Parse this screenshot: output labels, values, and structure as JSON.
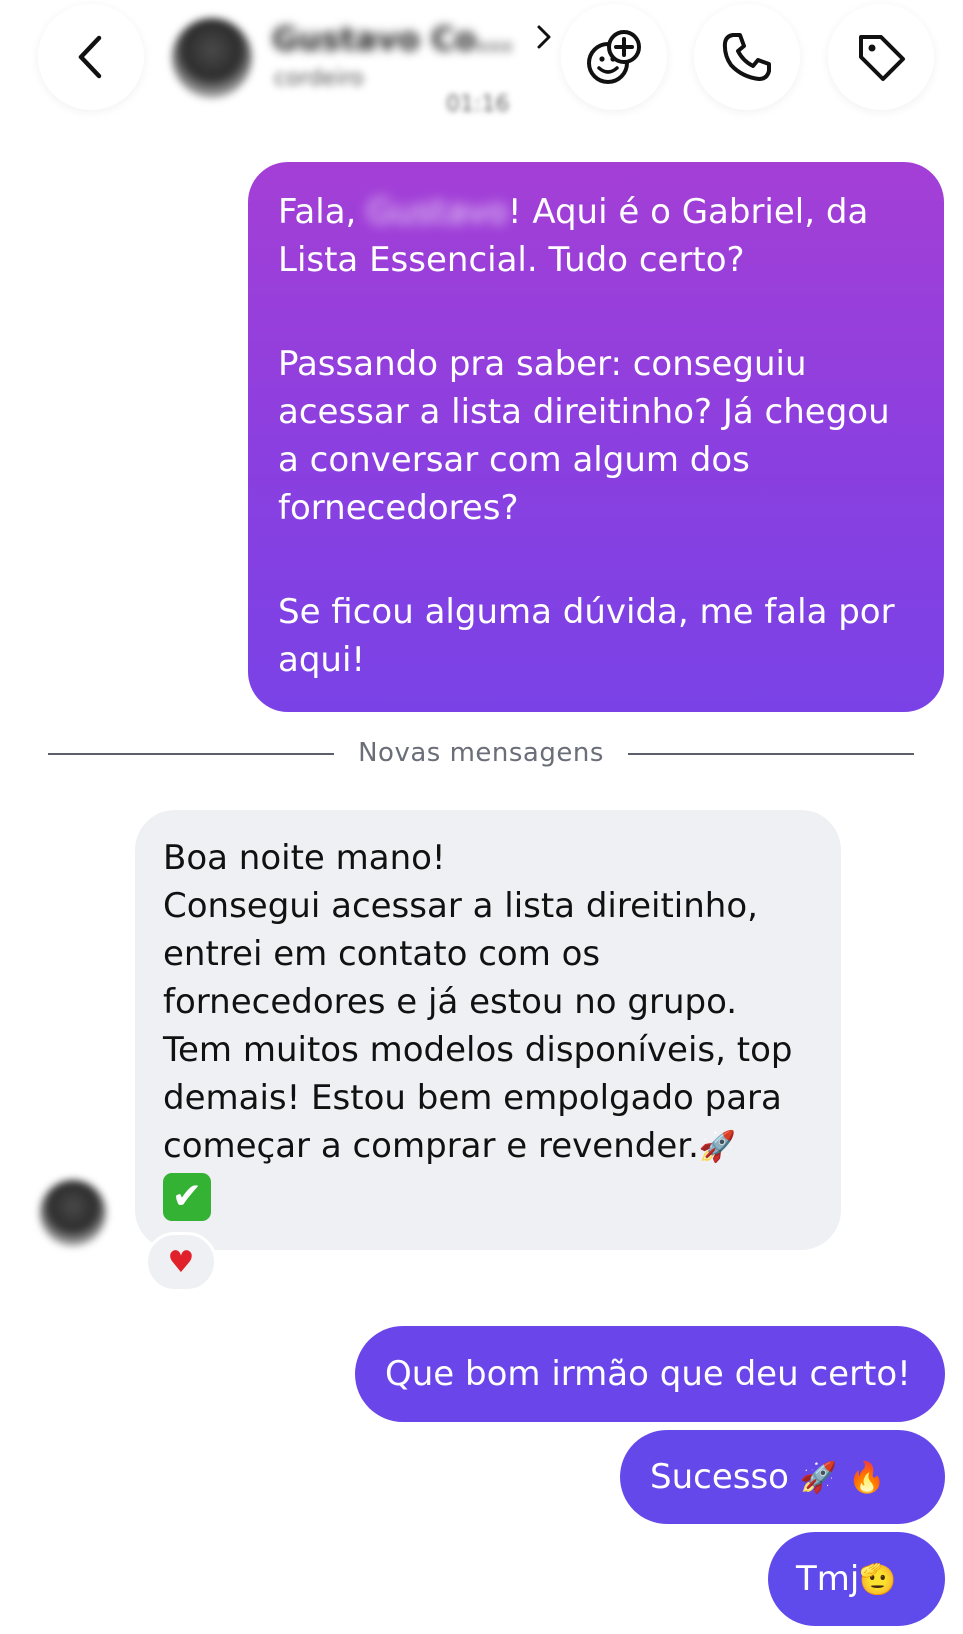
{
  "header": {
    "contact_name": "Gustavo Co...",
    "contact_status": "cordeiro",
    "time": "01:16",
    "icons": {
      "back": "back-chevron-icon",
      "sticker": "sticker-add-icon",
      "call": "phone-icon",
      "tag": "tag-icon",
      "profile_chevron": "chevron-right-icon"
    }
  },
  "messages": {
    "outgoing_1": {
      "line1_prefix": "Fala, ",
      "line1_name": "Gustavo",
      "line1_suffix": "! Aqui é o Gabriel, da",
      "line2": "Lista Essencial. Tudo certo?",
      "para2_l1": "Passando pra saber: conseguiu",
      "para2_l2": "acessar a lista direitinho? Já chegou",
      "para2_l3": "a conversar com algum dos",
      "para2_l4": "fornecedores?",
      "para3_l1": "Se ficou alguma dúvida, me fala por",
      "para3_l2": "aqui!"
    },
    "divider_label": "Novas mensagens",
    "incoming_1": {
      "l1": "Boa noite mano!",
      "l2": "Consegui acessar a lista direitinho,",
      "l3": "entrei em contato com os",
      "l4": "fornecedores e já estou no grupo.",
      "l5": "Tem muitos modelos disponíveis, top",
      "l6": "demais! Estou bem empolgado para",
      "l7": "começar a comprar e revender.",
      "emoji_rocket": "🚀",
      "emoji_check": "✔",
      "reaction": "♥"
    },
    "outgoing_2": "Que bom irmão que deu certo!",
    "outgoing_3": {
      "text": "Sucesso",
      "emoji1": "🚀",
      "emoji2": "🔥"
    },
    "outgoing_4": {
      "text": "Tmj",
      "emoji": "🫡"
    }
  },
  "colors": {
    "bubble_gradient_top": "#a43fd6",
    "bubble_gradient_bottom": "#7a42e6",
    "bubble_outgoing": "#6a45ea",
    "bubble_incoming": "#eef0f4",
    "divider": "#5b5f6b"
  }
}
